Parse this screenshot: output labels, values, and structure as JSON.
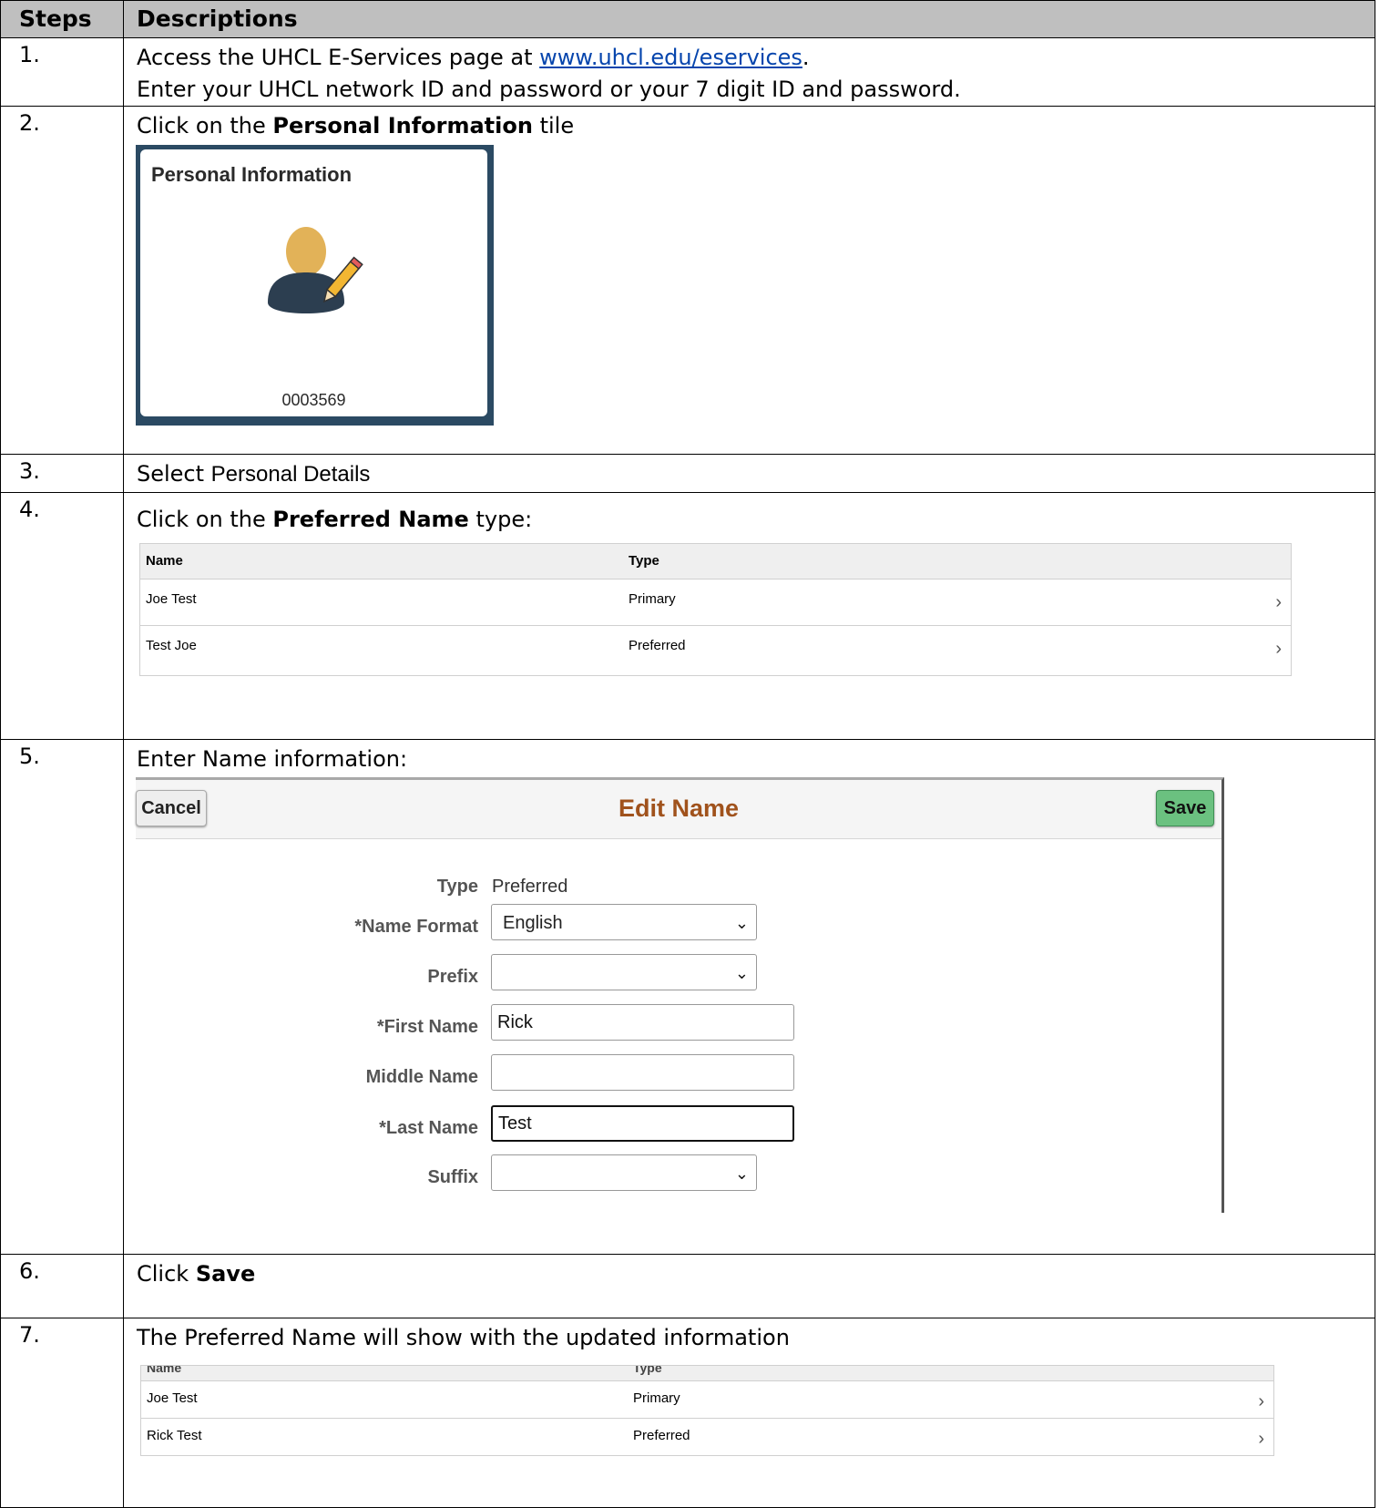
{
  "headers": {
    "steps": "Steps",
    "descriptions": "Descriptions"
  },
  "steps": [
    {
      "num": "1.",
      "text_a": "Access the UHCL E-Services page at ",
      "link": "www.uhcl.edu/eservices",
      "text_b": ".",
      "line2": "Enter your UHCL network ID and password or your 7 digit ID and password."
    },
    {
      "num": "2.",
      "pre": "Click on the ",
      "bold": "Personal Information",
      "post": " tile"
    },
    {
      "num": "3.",
      "pre": "Select ",
      "bold": "Personal Details"
    },
    {
      "num": "4.",
      "pre": "Click on the ",
      "bold": "Preferred Name",
      "post": " type:"
    },
    {
      "num": "5.",
      "text": "Enter Name information:"
    },
    {
      "num": "6.",
      "pre": "Click ",
      "bold": "Save"
    },
    {
      "num": "7.",
      "text": "The Preferred Name will show with the updated information"
    }
  ],
  "tile": {
    "title": "Personal Information",
    "number": "0003569",
    "icon": "person-edit-icon"
  },
  "grid4": {
    "col_name": "Name",
    "col_type": "Type",
    "rows": [
      {
        "name": "Joe Test",
        "type": "Primary",
        "chev": "›"
      },
      {
        "name": "Test Joe",
        "type": "Preferred",
        "chev": "›"
      }
    ]
  },
  "edit": {
    "cancel": "Cancel",
    "title": "Edit Name",
    "save": "Save",
    "type_label": "Type",
    "type_value": "Preferred",
    "name_format_label": "*Name Format",
    "name_format_value": "English",
    "prefix_label": "Prefix",
    "prefix_value": "",
    "first_label": "*First Name",
    "first_value": "Rick",
    "middle_label": "Middle Name",
    "middle_value": "",
    "last_label": "*Last Name",
    "last_value": "Test",
    "suffix_label": "Suffix",
    "suffix_value": "",
    "arrow": "⌄"
  },
  "grid7": {
    "col_name": "Name",
    "col_type": "Type",
    "rows": [
      {
        "name": "Joe Test",
        "type": "Primary",
        "chev": "›"
      },
      {
        "name": "Rick Test",
        "type": "Preferred",
        "chev": "›"
      }
    ]
  },
  "colors": {
    "tile_border": "#2b4a63",
    "edit_title": "#a0521c",
    "save_button": "#6bc180",
    "link": "#0645ad"
  }
}
